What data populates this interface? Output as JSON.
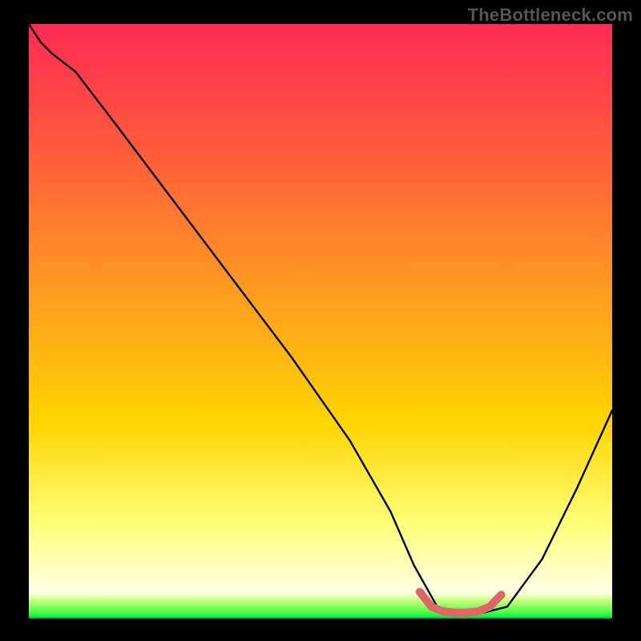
{
  "watermark": "TheBottleneck.com",
  "chart_data": {
    "type": "line",
    "title": "",
    "xlabel": "",
    "ylabel": "",
    "xlim": [
      0,
      100
    ],
    "ylim": [
      0,
      100
    ],
    "background_gradient": {
      "top": "#ff2a55",
      "middle": "#ffd400",
      "bottom_band": "#00e84a"
    },
    "series": [
      {
        "name": "curve",
        "color": "#000000",
        "x": [
          0,
          2,
          4,
          8,
          15,
          25,
          35,
          45,
          55,
          62,
          66,
          70,
          74,
          78,
          82,
          88,
          94,
          100
        ],
        "y": [
          100,
          97,
          95,
          92,
          83,
          70,
          57,
          44,
          30,
          18,
          9,
          2,
          1,
          1,
          2,
          10,
          22,
          35
        ]
      }
    ],
    "highlight": {
      "name": "trough-band",
      "color": "#e06666",
      "x": [
        67,
        69,
        71,
        73,
        75,
        77,
        79,
        81
      ],
      "y": [
        4.5,
        2.0,
        1.2,
        1.0,
        1.0,
        1.2,
        2.0,
        4.0
      ]
    }
  }
}
